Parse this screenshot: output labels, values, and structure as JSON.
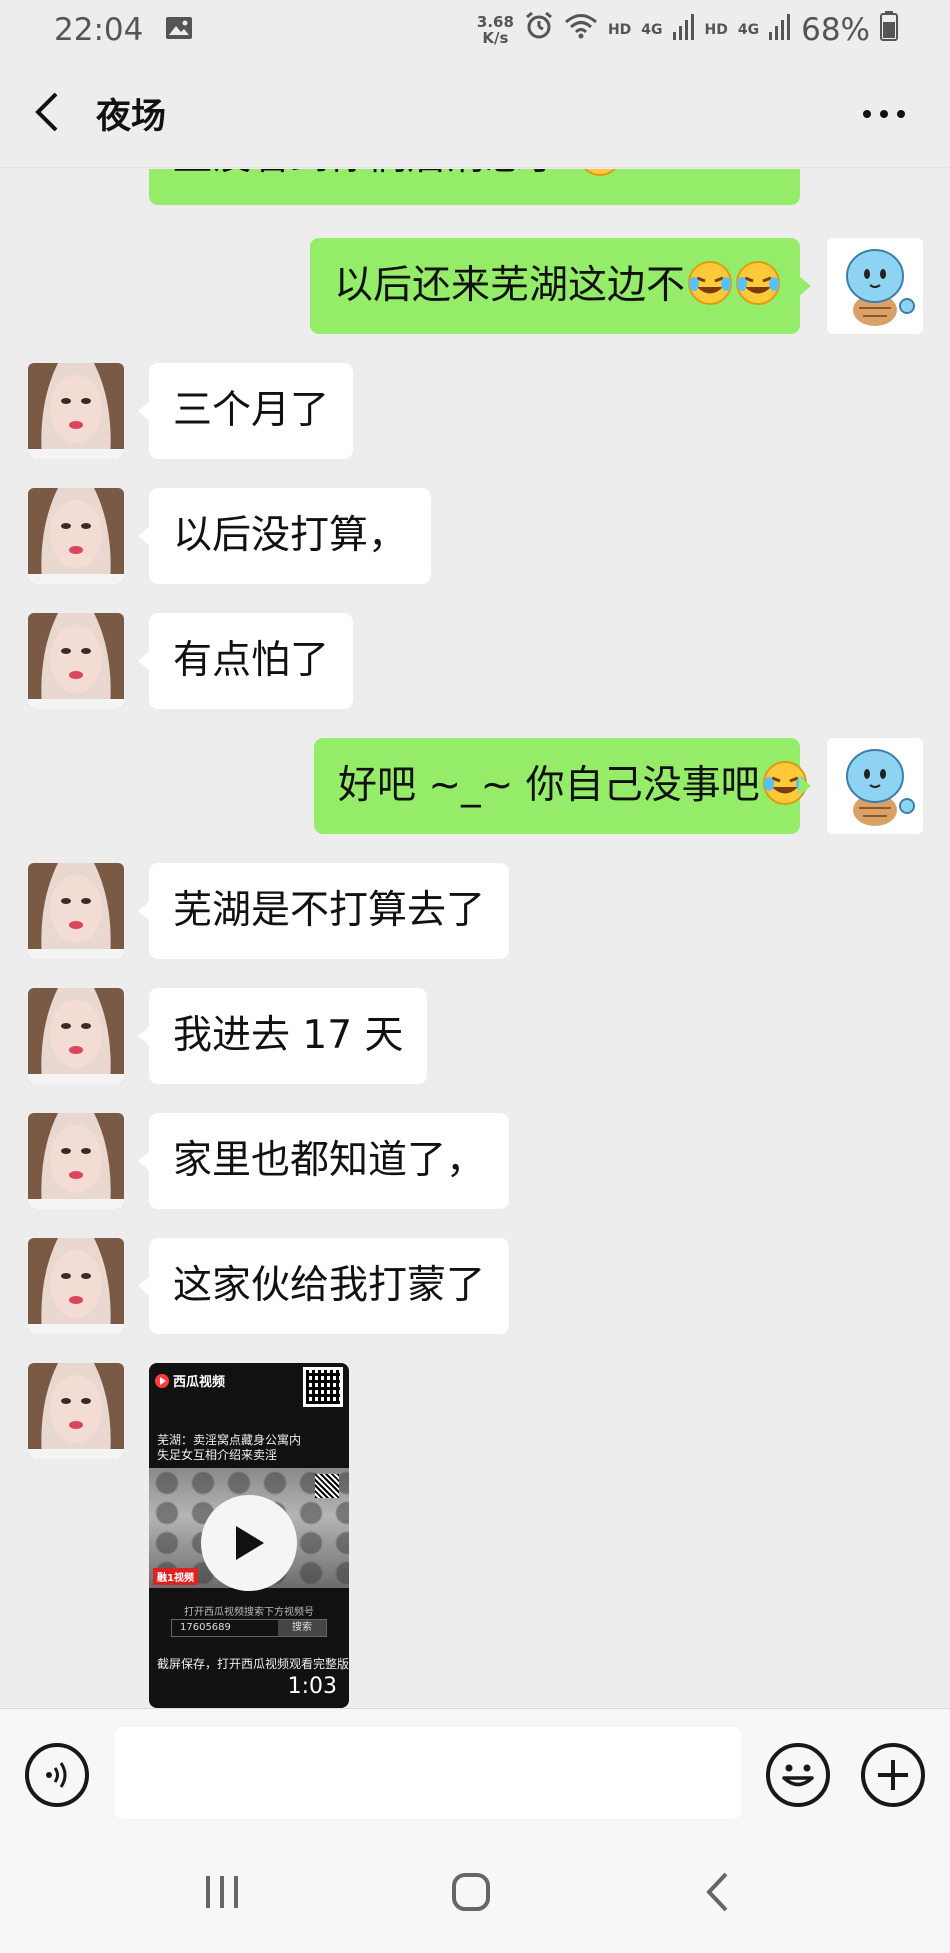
{
  "status_bar": {
    "time": "22:04",
    "net_speed_value": "3.68",
    "net_speed_unit": "K/s",
    "hd_label_1": "HD",
    "net_type_1": "4G",
    "hd_label_2": "HD",
    "net_type_2": "4G",
    "battery": "68%",
    "icons": [
      "gallery-icon",
      "alarm-icon",
      "wifi-icon",
      "signal-icon",
      "battery-icon"
    ]
  },
  "header": {
    "title": "夜场",
    "back_icon": "chevron-left-icon",
    "more_icon": "more-dots-icon"
  },
  "messages": [
    {
      "side": "right",
      "text": "直没看到你们后消息了",
      "emoji_count": 1,
      "partial": true
    },
    {
      "side": "right",
      "text": "以后还来芜湖这边不",
      "emoji_count": 2
    },
    {
      "side": "left",
      "text": "三个月了"
    },
    {
      "side": "left",
      "text": "以后没打算，"
    },
    {
      "side": "left",
      "text": "有点怕了"
    },
    {
      "side": "right",
      "text": "好吧 ~_~ 你自己没事吧",
      "emoji_count": 1
    },
    {
      "side": "left",
      "text": "芜湖是不打算去了"
    },
    {
      "side": "left",
      "text": "我进去 17 天"
    },
    {
      "side": "left",
      "text": "家里也都知道了，"
    },
    {
      "side": "left",
      "text": "这家伙给我打蒙了"
    }
  ],
  "video_card": {
    "app_name": "西瓜视频",
    "caption_line1": "芜湖：卖淫窝点藏身公寓内",
    "caption_line2": "失足女互相介绍来卖淫",
    "tag": "融1视频",
    "hint": "打开西瓜视频搜索下方视频号",
    "search_value": "17605689",
    "search_button": "搜索",
    "save_hint": "截屏保存，打开西瓜视频观看完整版",
    "duration": "1:03"
  },
  "input_bar": {
    "text_value": "",
    "voice_icon": "voice-icon",
    "emoji_icon": "emoji-icon",
    "plus_icon": "plus-icon"
  },
  "nav_bar": {
    "icons": [
      "recent-apps-icon",
      "home-icon",
      "back-icon"
    ]
  },
  "colors": {
    "background": "#ededed",
    "bubble_sent": "#95ec69",
    "bubble_received": "#ffffff"
  }
}
